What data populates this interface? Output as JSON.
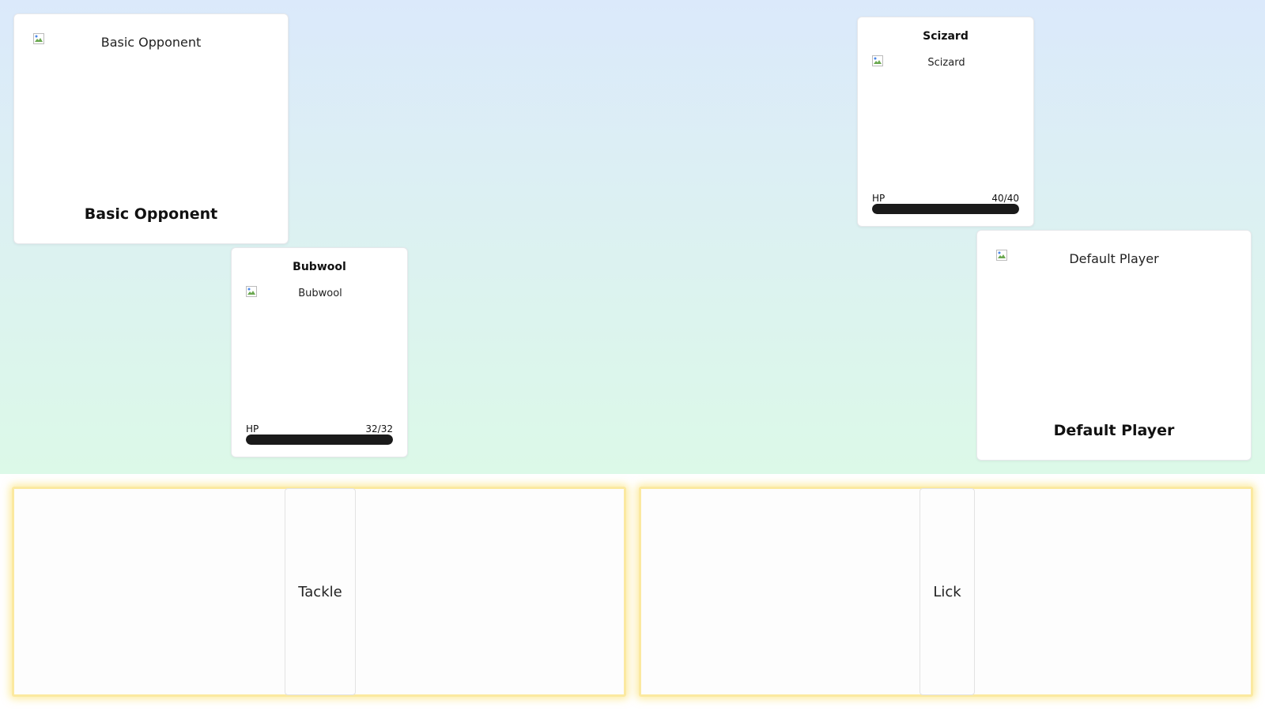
{
  "opponent": {
    "trainer": {
      "name": "Basic Opponent",
      "image_alt": "Basic Opponent"
    },
    "active": {
      "name": "Bubwool",
      "image_alt": "Bubwool",
      "hp_label": "HP",
      "hp_text": "32/32",
      "hp_fraction": 1.0
    }
  },
  "player": {
    "trainer": {
      "name": "Default Player",
      "image_alt": "Default Player"
    },
    "active": {
      "name": "Scizard",
      "image_alt": "Scizard",
      "hp_label": "HP",
      "hp_text": "40/40",
      "hp_fraction": 1.0
    }
  },
  "moves": [
    {
      "label": "Tackle"
    },
    {
      "label": "Lick"
    }
  ],
  "colors": {
    "hp_fill": "#1a1a1a",
    "panel_glow": "#fbe9a0",
    "sky_top": "#dbe9fb",
    "sky_bottom": "#dcf9e8"
  },
  "icons": {
    "broken_image": "broken-image-icon"
  }
}
